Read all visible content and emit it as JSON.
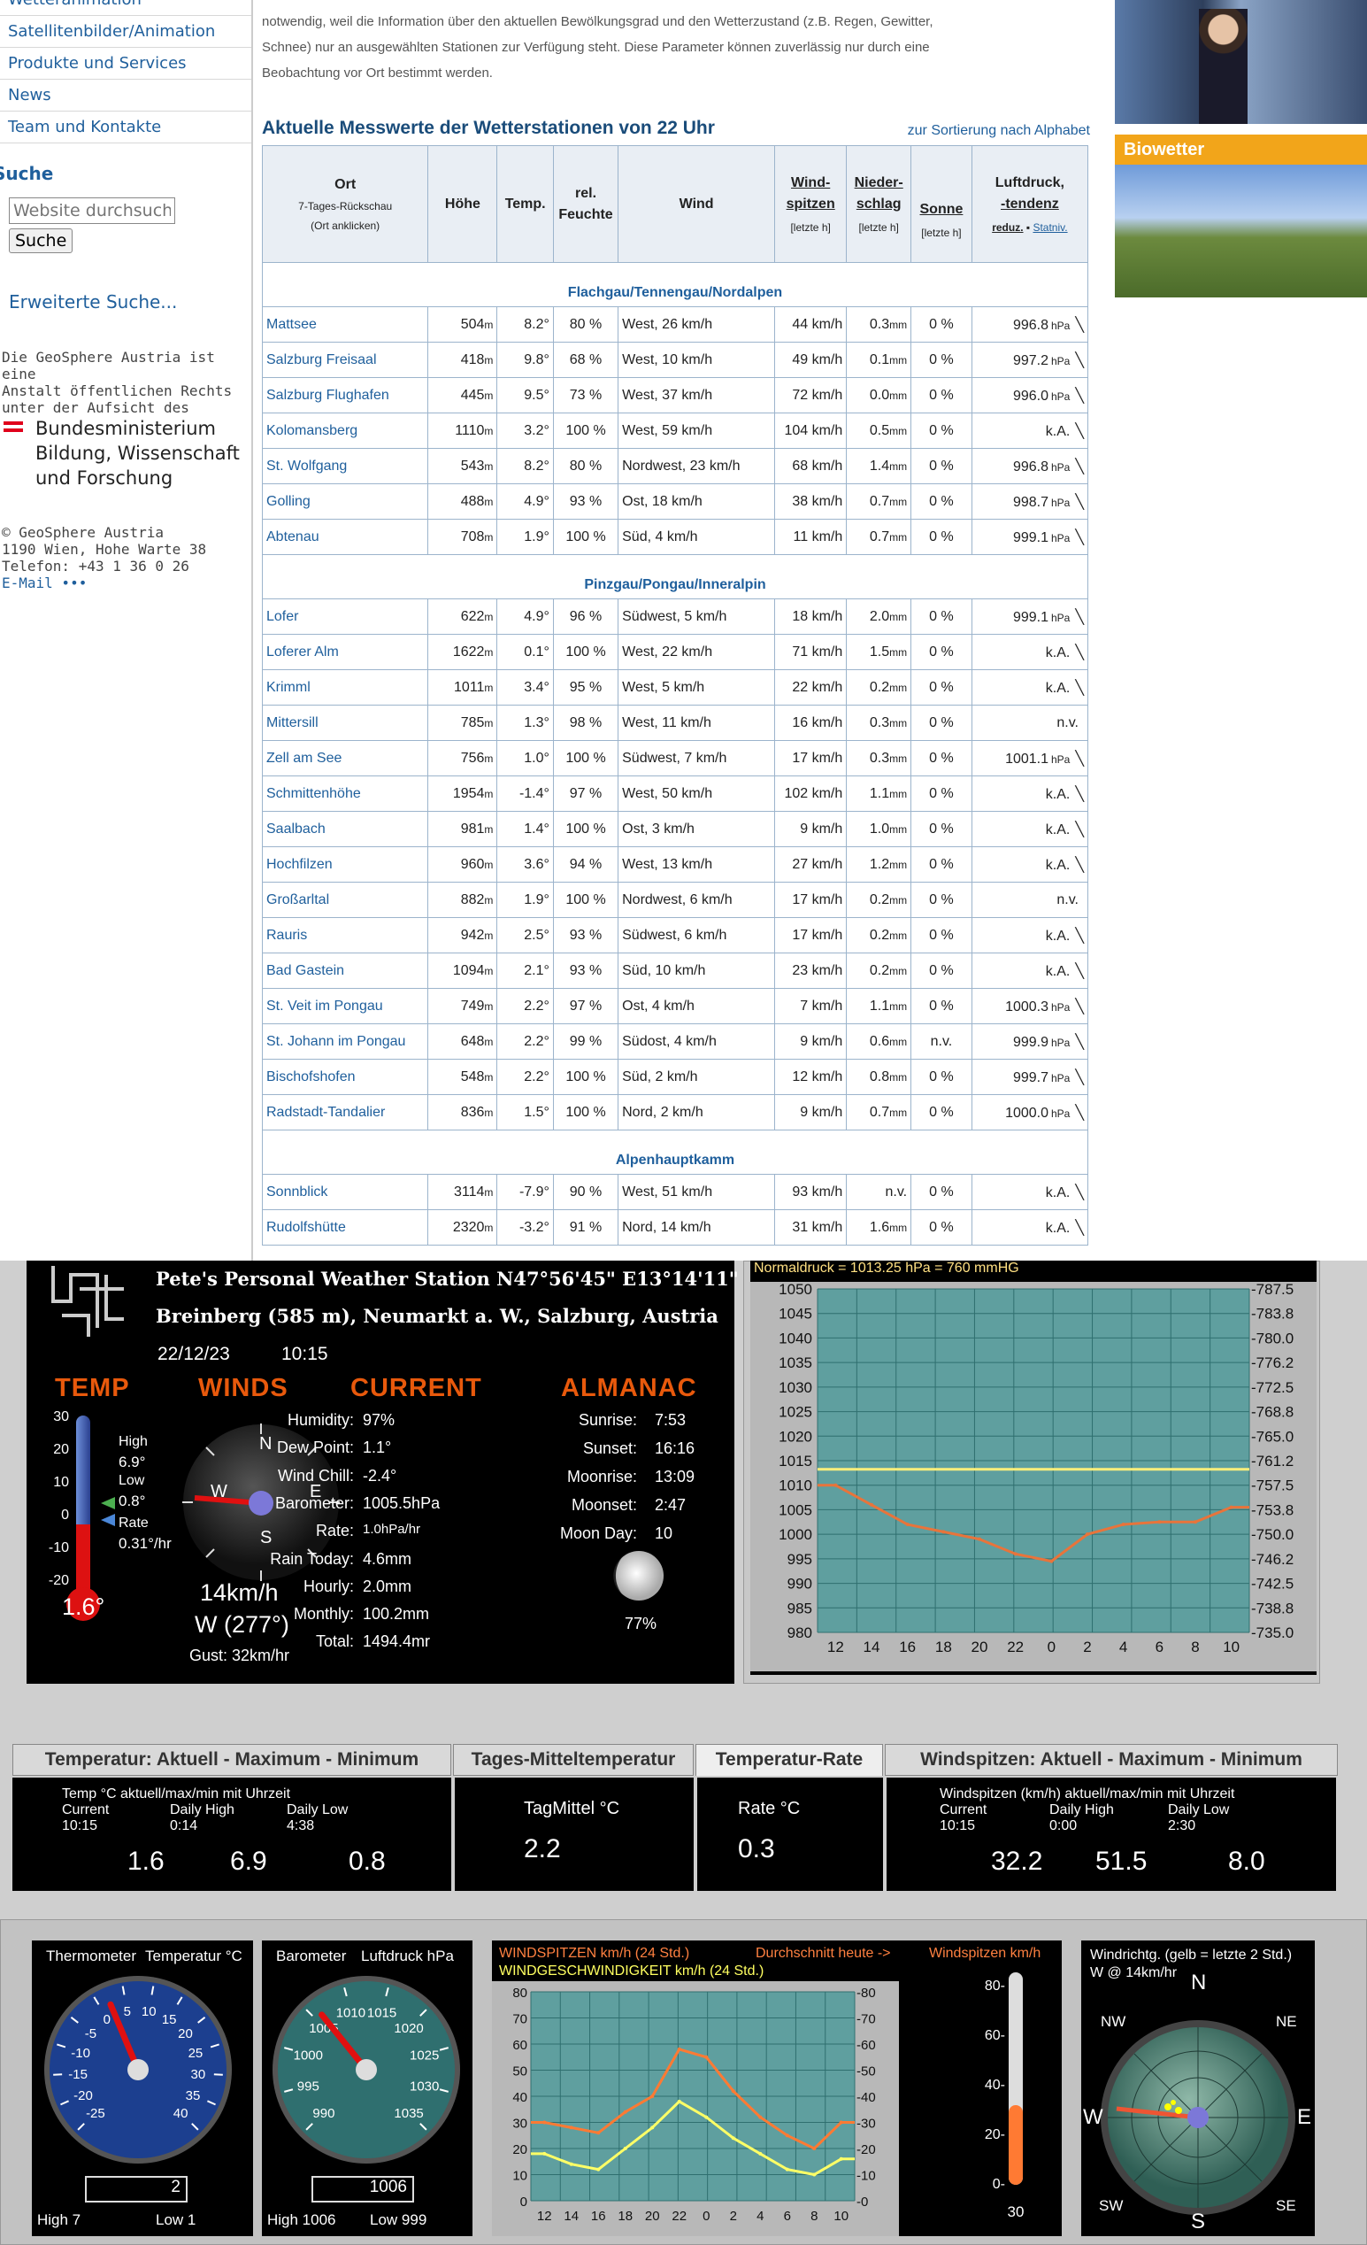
{
  "nav": {
    "items": [
      "Wetteranimation",
      "Satellitenbilder/Animation",
      "Produkte und Services",
      "News",
      "Team und Kontakte"
    ],
    "search_heading": "Suche",
    "search_placeholder": "Website durchsuchen",
    "search_button": "Suche",
    "advanced_search": "Erweiterte Suche...",
    "legal_text": [
      "Die GeoSphere Austria ist eine",
      "Anstalt öffentlichen Rechts",
      "unter der Aufsicht des"
    ],
    "ministry": [
      "Bundesministerium",
      "Bildung, Wissenschaft",
      "und Forschung"
    ],
    "address": [
      "© GeoSphere Austria",
      "1190 Wien, Hohe Warte 38",
      "Telefon: +43 1 36 0 26"
    ],
    "email": "E-Mail •••"
  },
  "intro": {
    "lines": [
      "notwendig, weil die Information über den aktuellen Bewölkungsgrad und den Wetterzustand (z.B. Regen, Gewitter,",
      "Schnee) nur an ausgewählten Stationen zur Verfügung steht. Diese Parameter können zuverlässig nur durch eine",
      "Beobachtung vor Ort bestimmt werden."
    ]
  },
  "table": {
    "title": "Aktuelle Messwerte der Wetterstationen von 22 Uhr",
    "sort_link": "zur Sortierung nach Alphabet",
    "headers": {
      "ort": "Ort",
      "ort_sub1": "7-Tages-Rückschau",
      "ort_sub2": "(Ort anklicken)",
      "hoehe": "Höhe",
      "temp": "Temp.",
      "feuchte1": "rel.",
      "feuchte2": "Feuchte",
      "wind": "Wind",
      "spitzen1": "Wind-",
      "spitzen2": "spitzen",
      "spitzen_sub": "[letzte h]",
      "nieder1": "Nieder-",
      "nieder2": "schlag",
      "nieder_sub": "[letzte h]",
      "sonne": "Sonne",
      "sonne_sub": "[letzte h]",
      "luft1": "Luftdruck,",
      "luft2": "-tendenz",
      "luft_sub1": "reduz.",
      "luft_sub2": "Statniv."
    },
    "groups": [
      {
        "name": "Flachgau/Tennengau/Nordalpen",
        "rows": [
          [
            "Mattsee",
            "504",
            "8.2°",
            "80 %",
            "West, 26 km/h",
            "44 km/h",
            "0.3",
            "0 %",
            "996.8",
            "╲"
          ],
          [
            "Salzburg Freisaal",
            "418",
            "9.8°",
            "68 %",
            "West, 10 km/h",
            "49 km/h",
            "0.1",
            "0 %",
            "997.2",
            "╲"
          ],
          [
            "Salzburg Flughafen",
            "445",
            "9.5°",
            "73 %",
            "West, 37 km/h",
            "72 km/h",
            "0.0",
            "0 %",
            "996.0",
            "╲"
          ],
          [
            "Kolomansberg",
            "1110",
            "3.2°",
            "100 %",
            "West, 59 km/h",
            "104 km/h",
            "0.5",
            "0 %",
            "k.A.",
            "╲"
          ],
          [
            "St. Wolfgang",
            "543",
            "8.2°",
            "80 %",
            "Nordwest, 23 km/h",
            "68 km/h",
            "1.4",
            "0 %",
            "996.8",
            "╲"
          ],
          [
            "Golling",
            "488",
            "4.9°",
            "93 %",
            "Ost, 18 km/h",
            "38 km/h",
            "0.7",
            "0 %",
            "998.7",
            "╲"
          ],
          [
            "Abtenau",
            "708",
            "1.9°",
            "100 %",
            "Süd, 4 km/h",
            "11 km/h",
            "0.7",
            "0 %",
            "999.1",
            "╲"
          ]
        ]
      },
      {
        "name": "Pinzgau/Pongau/Inneralpin",
        "rows": [
          [
            "Lofer",
            "622",
            "4.9°",
            "96 %",
            "Südwest, 5 km/h",
            "18 km/h",
            "2.0",
            "0 %",
            "999.1",
            "╲"
          ],
          [
            "Loferer Alm",
            "1622",
            "0.1°",
            "100 %",
            "West, 22 km/h",
            "71 km/h",
            "1.5",
            "0 %",
            "k.A.",
            "╲"
          ],
          [
            "Krimml",
            "1011",
            "3.4°",
            "95 %",
            "West, 5 km/h",
            "22 km/h",
            "0.2",
            "0 %",
            "k.A.",
            "╲"
          ],
          [
            "Mittersill",
            "785",
            "1.3°",
            "98 %",
            "West, 11 km/h",
            "16 km/h",
            "0.3",
            "0 %",
            "n.v.",
            ""
          ],
          [
            "Zell am See",
            "756",
            "1.0°",
            "100 %",
            "Südwest, 7 km/h",
            "17 km/h",
            "0.3",
            "0 %",
            "1001.1",
            "╲"
          ],
          [
            "Schmittenhöhe",
            "1954",
            "-1.4°",
            "97 %",
            "West, 50 km/h",
            "102 km/h",
            "1.1",
            "0 %",
            "k.A.",
            "╲"
          ],
          [
            "Saalbach",
            "981",
            "1.4°",
            "100 %",
            "Ost, 3 km/h",
            "9 km/h",
            "1.0",
            "0 %",
            "k.A.",
            "╲"
          ],
          [
            "Hochfilzen",
            "960",
            "3.6°",
            "94 %",
            "West, 13 km/h",
            "27 km/h",
            "1.2",
            "0 %",
            "k.A.",
            "╲"
          ],
          [
            "Großarltal",
            "882",
            "1.9°",
            "100 %",
            "Nordwest, 6 km/h",
            "17 km/h",
            "0.2",
            "0 %",
            "n.v.",
            ""
          ],
          [
            "Rauris",
            "942",
            "2.5°",
            "93 %",
            "Südwest, 6 km/h",
            "17 km/h",
            "0.2",
            "0 %",
            "k.A.",
            "╲"
          ],
          [
            "Bad Gastein",
            "1094",
            "2.1°",
            "93 %",
            "Süd, 10 km/h",
            "23 km/h",
            "0.2",
            "0 %",
            "k.A.",
            "╲"
          ],
          [
            "St. Veit im Pongau",
            "749",
            "2.2°",
            "97 %",
            "Ost, 4 km/h",
            "7 km/h",
            "1.1",
            "0 %",
            "1000.3",
            "╲"
          ],
          [
            "St. Johann im Pongau",
            "648",
            "2.2°",
            "99 %",
            "Südost, 4 km/h",
            "9 km/h",
            "0.6",
            "n.v.",
            "999.9",
            "╲"
          ],
          [
            "Bischofshofen",
            "548",
            "2.2°",
            "100 %",
            "Süd, 2 km/h",
            "12 km/h",
            "0.8",
            "0 %",
            "999.7",
            "╲"
          ],
          [
            "Radstadt-Tandalier",
            "836",
            "1.5°",
            "100 %",
            "Nord, 2 km/h",
            "9 km/h",
            "0.7",
            "0 %",
            "1000.0",
            "╲"
          ]
        ]
      },
      {
        "name": "Alpenhauptkamm",
        "rows": [
          [
            "Sonnblick",
            "3114",
            "-7.9°",
            "90 %",
            "West, 51 km/h",
            "93 km/h",
            "n.v.",
            "0 %",
            "k.A.",
            "╲"
          ],
          [
            "Rudolfshütte",
            "2320",
            "-3.2°",
            "91 %",
            "Nord, 14 km/h",
            "31 km/h",
            "1.6",
            "0 %",
            "k.A.",
            "╲"
          ]
        ]
      }
    ],
    "units": {
      "m": "m",
      "mm": "mm",
      "hpa": "hPa"
    }
  },
  "right": {
    "biowetter": "Biowetter"
  },
  "station": {
    "title": "Pete's Personal Weather Station N47°56'45\"  E13°14'11\"",
    "location": "Breinberg (585 m), Neumarkt a. W., Salzburg, Austria",
    "date": "22/12/23",
    "time": "10:15",
    "headers": {
      "temp": "TEMP",
      "winds": "WINDS",
      "current": "CURRENT",
      "almanac": "ALMANAC"
    },
    "temp": {
      "high_label": "High",
      "high": "6.9°",
      "low_label": "Low",
      "low": "0.8°",
      "rate_label": "Rate",
      "rate": "0.31°/hr",
      "current": "1.6°",
      "ticks": [
        "30",
        "20",
        "10",
        "0",
        "-10",
        "-20"
      ]
    },
    "wind": {
      "speed": "14km/h",
      "dir": "W (277°)",
      "gust": "Gust:  32km/hr",
      "N": "N",
      "E": "E",
      "S": "S",
      "W": "W"
    },
    "current": {
      "labels": [
        "Humidity:",
        "Dew Point:",
        "Wind Chill:",
        "Barometer:",
        "Rate:",
        "Rain Today:",
        "Hourly:",
        "Monthly:",
        "Total:"
      ],
      "values": [
        "97%",
        "1.1°",
        "-2.4°",
        "1005.5hPa",
        "1.0hPa/hr",
        "4.6mm",
        "2.0mm",
        "100.2mm",
        "1494.4mr"
      ]
    },
    "almanac": {
      "labels": [
        "Sunrise:",
        "Sunset:",
        "Moonrise:",
        "Moonset:",
        "Moon Day:"
      ],
      "values": [
        "7:53",
        "16:16",
        "13:09",
        "2:47",
        "10"
      ],
      "moon_pct": "77%"
    }
  },
  "pressure_chart": {
    "legend": "Normaldruck = 1013.25 hPa = 760 mmHG",
    "left_ticks": [
      "1050",
      "1045",
      "1040",
      "1035",
      "1030",
      "1025",
      "1020",
      "1015",
      "1010",
      "1005",
      "1000",
      "995",
      "990",
      "985",
      "980"
    ],
    "right_ticks": [
      "-787.5",
      "-783.8",
      "-780.0",
      "-776.2",
      "-772.5",
      "-768.8",
      "-765.0",
      "-761.2",
      "-757.5",
      "-753.8",
      "-750.0",
      "-746.2",
      "-742.5",
      "-738.8",
      "-735.0"
    ],
    "x_ticks": [
      "12",
      "14",
      "16",
      "18",
      "20",
      "22",
      "0",
      "2",
      "4",
      "6",
      "8",
      "10"
    ]
  },
  "chart_data": [
    {
      "type": "line",
      "ylabel": "",
      "ylim": [
        980,
        1050
      ],
      "x": [
        "12",
        "14",
        "16",
        "18",
        "20",
        "22",
        "0",
        "2",
        "4",
        "6",
        "8",
        "10"
      ],
      "series": [
        {
          "values": [
            1010,
            1006,
            1002,
            1000.5,
            999,
            996,
            994.5,
            1000,
            1002,
            1002.5,
            1002.5,
            1005.5
          ]
        }
      ],
      "reference_line": 1013.25
    },
    {
      "type": "line",
      "ylim": [
        0,
        80
      ],
      "x": [
        "12",
        "14",
        "16",
        "18",
        "20",
        "22",
        "0",
        "2",
        "4",
        "6",
        "8",
        "10"
      ],
      "series": [
        {
          "name": "WINDSPITZEN km/h (24 Std.)",
          "values": [
            30,
            28,
            26,
            34,
            40,
            58,
            55,
            42,
            32,
            25,
            20,
            30
          ]
        },
        {
          "name": "WINDGESCHWINDIGKEIT km/h (24 Std.)",
          "values": [
            18,
            14,
            12,
            20,
            28,
            38,
            32,
            24,
            18,
            12,
            10,
            16
          ]
        }
      ]
    }
  ],
  "tabs": [
    {
      "label": "Temperatur: Aktuell - Maximum - Minimum"
    },
    {
      "label": "Tages-Mitteltemperatur"
    },
    {
      "label": "Temperatur-Rate"
    },
    {
      "label": "Windspitzen: Aktuell - Maximum - Minimum"
    }
  ],
  "readouts": {
    "temp": {
      "caption": "Temp °C  aktuell/max/min mit Uhrzeit",
      "c1": "Current",
      "t1": "10:15",
      "v1": "1.6",
      "c2": "Daily High",
      "t2": "0:14",
      "v2": "6.9",
      "c3": "Daily Low",
      "t3": "4:38",
      "v3": "0.8"
    },
    "mittel": {
      "caption": "TagMittel °C",
      "value": "2.2"
    },
    "rate": {
      "caption": "Rate  °C",
      "value": "0.3"
    },
    "wind": {
      "caption": "Windspitzen (km/h) aktuell/max/min mit Uhrzeit",
      "c1": "Current",
      "t1": "10:15",
      "v1": "32.2",
      "c2": "Daily High",
      "t2": "0:00",
      "v2": "51.5",
      "c3": "Daily Low",
      "t3": "2:30",
      "v3": "8.0"
    }
  },
  "gauges": {
    "thermo": {
      "title": "Thermometer",
      "unit": "Temperatur °C",
      "display": "2",
      "high": "High  7",
      "low": "Low  1",
      "ticks": [
        "-25",
        "-20",
        "-15",
        "-10",
        "-5",
        "0",
        "5",
        "10",
        "15",
        "20",
        "25",
        "30",
        "35",
        "40"
      ]
    },
    "baro": {
      "title": "Barometer",
      "unit": "Luftdruck hPa",
      "display": "1006",
      "high": "High  1006",
      "low": "Low  999",
      "ticks": [
        "990",
        "995",
        "1000",
        "1005",
        "1010",
        "1015",
        "1020",
        "1025",
        "1030",
        "1035"
      ]
    },
    "wind_chart": {
      "title_peaks": "WINDSPITZEN km/h (24 Std.)",
      "avg_today": "Durchschnitt heute ->",
      "peaks_unit": "Windspitzen  km/h",
      "title_speed": "WINDGESCHWINDIGKEIT km/h (24 Std.)",
      "y_ticks": [
        "80",
        "70",
        "60",
        "50",
        "40",
        "30",
        "20",
        "10",
        "0"
      ],
      "right_ticks": [
        "-80",
        "-70",
        "-60",
        "-50",
        "-40",
        "-30",
        "-20",
        "-10",
        "-0"
      ],
      "x_ticks": [
        "12",
        "14",
        "16",
        "18",
        "20",
        "22",
        "0",
        "2",
        "4",
        "6",
        "8",
        "10"
      ]
    },
    "bar": {
      "ticks": [
        "80-",
        "60-",
        "40-",
        "20-",
        "0-"
      ],
      "value": "30"
    },
    "compass": {
      "title": "Windrichtg. (gelb = letzte 2 Std.)",
      "sub": "W @ 14km/hr",
      "N": "N",
      "NE": "NE",
      "E": "E",
      "SE": "SE",
      "S": "S",
      "SW": "SW",
      "W": "W",
      "NW": "NW"
    }
  }
}
